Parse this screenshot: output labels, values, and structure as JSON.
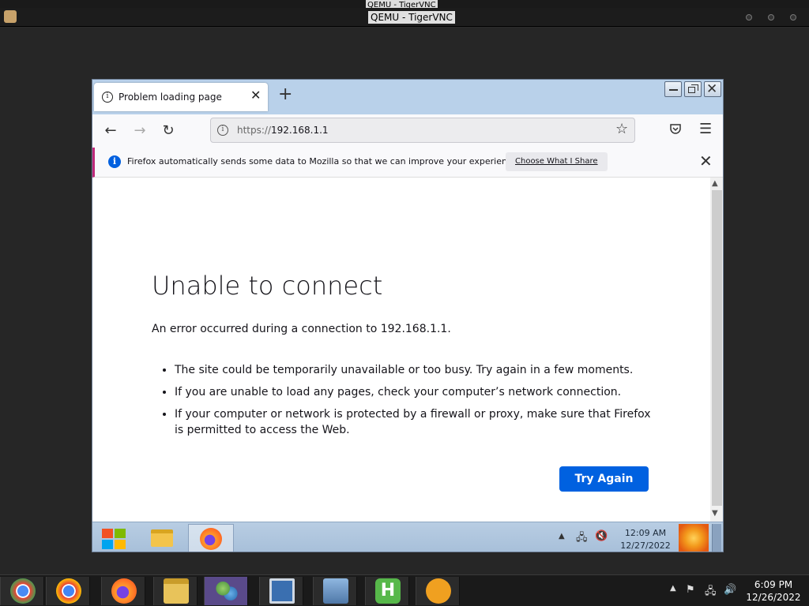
{
  "vnc": {
    "title": "QEMU - TigerVNC"
  },
  "browser": {
    "tab_title": "Problem loading page",
    "url_prefix": "https://",
    "url_host": "192.168.1.1",
    "notification": {
      "text": "Firefox automatically sends some data to Mozilla so that we can improve your experience.",
      "button": "Choose What I Share"
    },
    "error": {
      "title": "Unable to connect",
      "description": "An error occurred during a connection to 192.168.1.1.",
      "bullets": [
        "The site could be temporarily unavailable or too busy. Try again in a few moments.",
        "If you are unable to load any pages, check your computer’s network connection.",
        "If your computer or network is protected by a firewall or proxy, make sure that Firefox is permitted to access the Web."
      ],
      "button": "Try Again"
    }
  },
  "guest_taskbar": {
    "time": "12:09 AM",
    "date": "12/27/2022",
    "apps": [
      "start-icon",
      "file-explorer-icon",
      "firefox-icon"
    ]
  },
  "host_taskbar": {
    "time": "6:09 PM",
    "date": "12/26/2022",
    "apps": [
      "chromium-icon",
      "chrome-icon",
      "firefox-icon",
      "file-manager-icon",
      "network-icon",
      "remote-desktop-icon",
      "installer-icon",
      "hoster-icon",
      "tigervnc-icon"
    ]
  },
  "colors": {
    "accent": "#0061e0",
    "tab_strip": "#b9d1ea",
    "notif_border": "#c0297a"
  }
}
